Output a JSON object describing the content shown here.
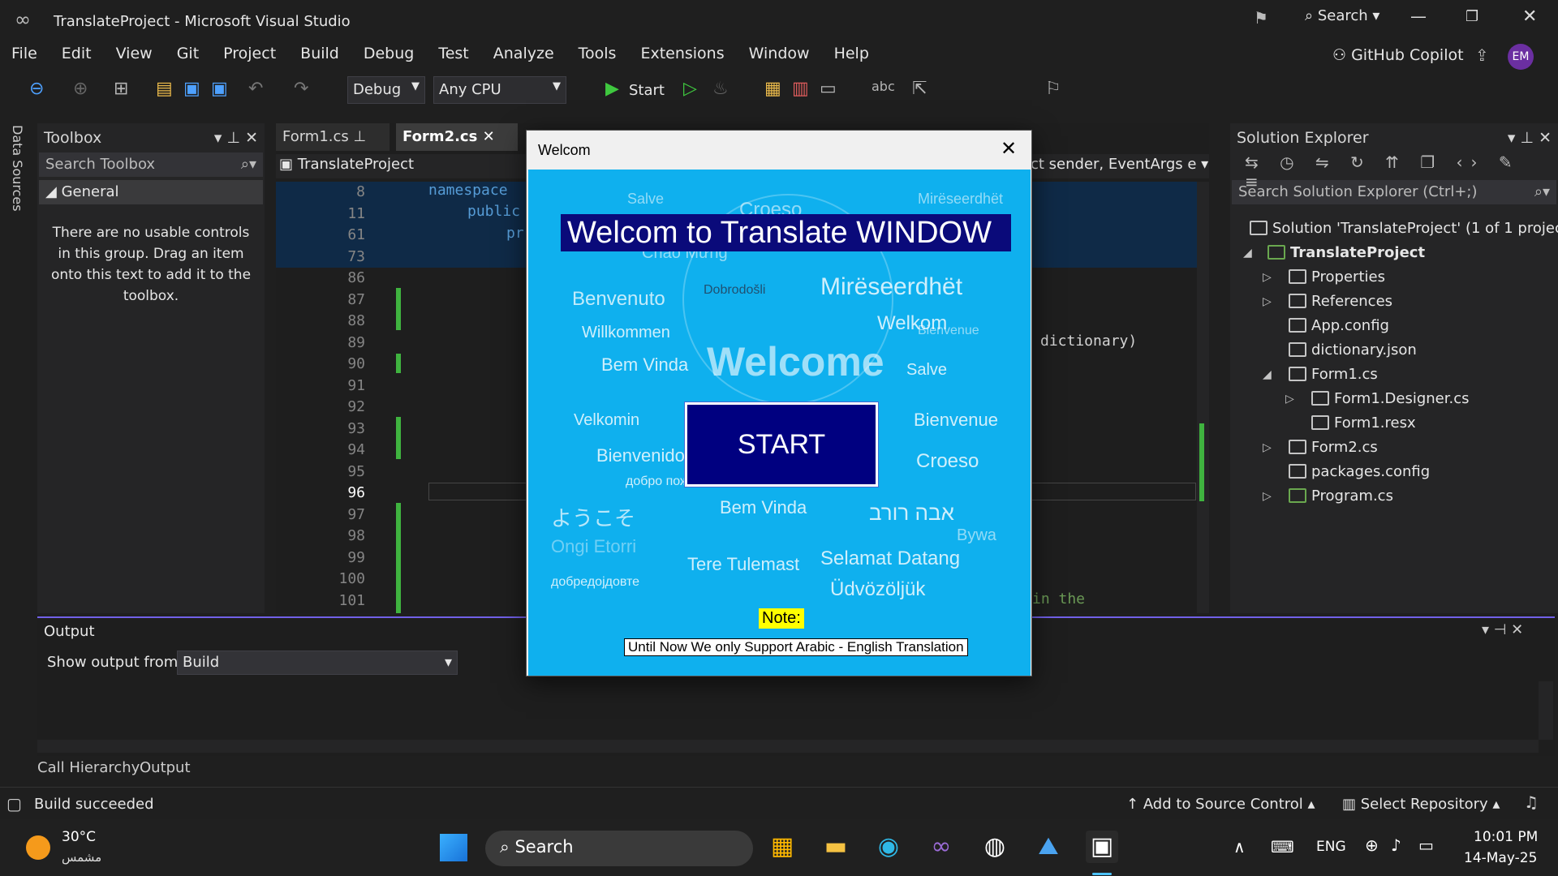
{
  "window": {
    "title": "TranslateProject - Microsoft Visual Studio",
    "search": "Search",
    "copilot": "GitHub Copilot",
    "avatar": "EM"
  },
  "menu": [
    "File",
    "Edit",
    "View",
    "Git",
    "Project",
    "Build",
    "Debug",
    "Test",
    "Analyze",
    "Tools",
    "Extensions",
    "Window",
    "Help"
  ],
  "toolbar": {
    "config": "Debug",
    "platform": "Any CPU",
    "start": "Start"
  },
  "side_strip": "Data Sources",
  "toolbox": {
    "title": "Toolbox",
    "search": "Search Toolbox",
    "group": "General",
    "empty": "There are no usable controls in this group. Drag an item onto this text to add it to the toolbox."
  },
  "editor": {
    "tabs": [
      "Form1.cs",
      "Form2.cs"
    ],
    "nav_left": "TranslateProject",
    "nav_right": "ct sender, EventArgs e",
    "line_numbers": [
      "8",
      "11",
      "61",
      "73",
      "86",
      "87",
      "88",
      "89",
      "90",
      "91",
      "92",
      "93",
      "94",
      "95",
      "96",
      "97",
      "98",
      "99",
      "100",
      "101"
    ],
    "code_namespace": "namespace",
    "code_public": "public",
    "code_pr": "pr",
    "code_dictionary": "dictionary)",
    "code_inthe": "in the"
  },
  "solution": {
    "title": "Solution Explorer",
    "search": "Search Solution Explorer (Ctrl+;)",
    "items": [
      {
        "label": "Solution 'TranslateProject' (1 of 1 project)"
      },
      {
        "label": "TranslateProject"
      },
      {
        "label": "Properties"
      },
      {
        "label": "References"
      },
      {
        "label": "App.config"
      },
      {
        "label": "dictionary.json"
      },
      {
        "label": "Form1.cs"
      },
      {
        "label": "Form1.Designer.cs"
      },
      {
        "label": "Form1.resx"
      },
      {
        "label": "Form2.cs"
      },
      {
        "label": "packages.config"
      },
      {
        "label": "Program.cs"
      }
    ]
  },
  "output": {
    "title": "Output",
    "show_from_label": "Show output from:",
    "show_from_value": "Build"
  },
  "bottom_tabs": [
    "Call Hierarchy",
    "Output"
  ],
  "status": {
    "build": "Build succeeded",
    "source_control": "Add to Source Control",
    "repo": "Select Repository"
  },
  "dialog": {
    "caption": "Welcom",
    "heading": "Welcom to Translate WINDOW",
    "start": "START",
    "note": "Note:",
    "support": "Until Now We only Support Arabic - English Translation",
    "cloud_words": [
      "Salve",
      "Croeso",
      "Mirëseerdhët",
      "Chào Mừng",
      "Benvenuto",
      "Dobrodošli",
      "Mirëseerdhët",
      "Willkommen",
      "Welkom",
      "Bem Vinda",
      "Welcome",
      "Salve",
      "Velkomin",
      "Bienvenue",
      "Bienvenido",
      "добро пожаловать",
      "Croeso",
      "ようこそ",
      "Bem Vinda",
      "אבה רורב",
      "Ongi Etorri",
      "Tere Tulemast",
      "Selamat Datang",
      "добредојдовте",
      "Üdvözöljük",
      "Bienvenue",
      "Bywa"
    ]
  },
  "taskbar": {
    "weather_temp": "30°C",
    "weather_desc": "مشمس",
    "search": "Search",
    "lang": "ENG",
    "time": "10:01 PM",
    "date": "14-May-25"
  },
  "colors": {
    "accent": "#0fb0ee",
    "start_bg": "#000080",
    "vs_purple": "#7160e8"
  }
}
